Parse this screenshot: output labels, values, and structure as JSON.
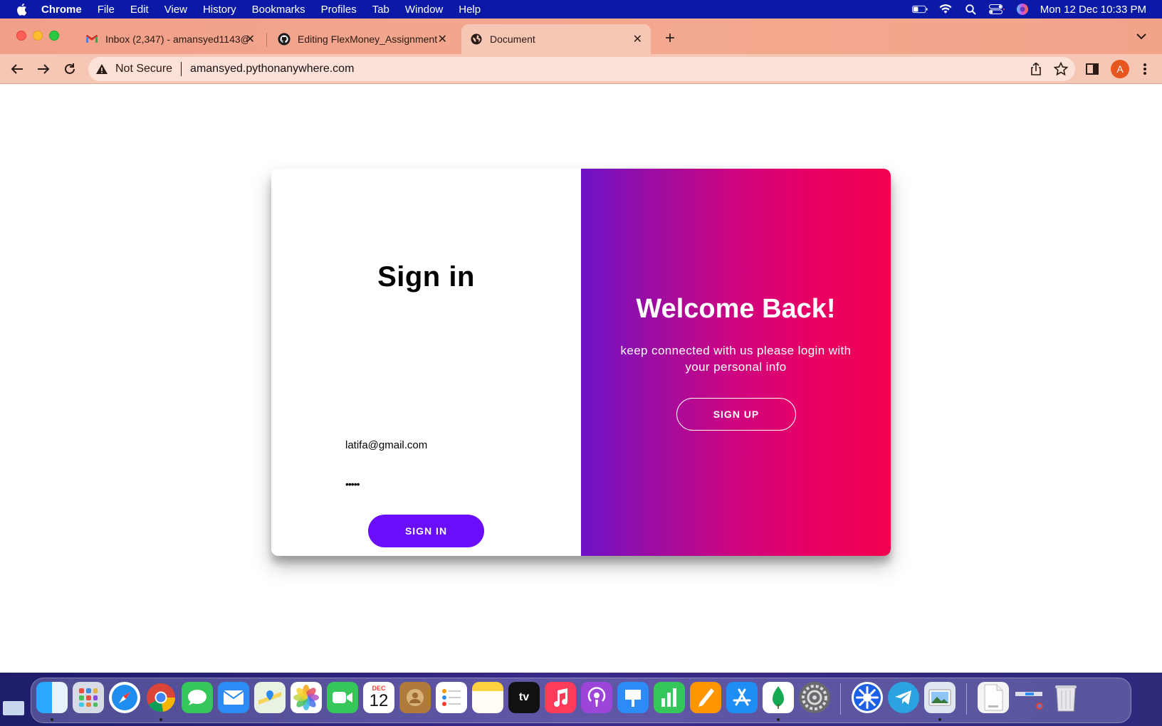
{
  "menubar": {
    "app_name": "Chrome",
    "items": [
      "File",
      "Edit",
      "View",
      "History",
      "Bookmarks",
      "Profiles",
      "Tab",
      "Window",
      "Help"
    ],
    "clock": "Mon 12 Dec  10:33 PM"
  },
  "tabs": [
    {
      "title": "Inbox (2,347) - amansyed1143@",
      "icon": "gmail-icon"
    },
    {
      "title": "Editing FlexMoney_Assignment",
      "icon": "github-icon"
    },
    {
      "title": "Document",
      "icon": "globe-icon",
      "active": true
    }
  ],
  "toolbar": {
    "security_label": "Not Secure",
    "url": "amansyed.pythonanywhere.com",
    "avatar_letter": "A"
  },
  "signin": {
    "title": "Sign in",
    "email_value": "latifa@gmail.com",
    "password_value": "•••••",
    "button_label": "SIGN IN"
  },
  "welcome": {
    "title": "Welcome Back!",
    "subtitle": "keep connected with us please login with your personal info",
    "button_label": "SIGN UP"
  },
  "dock": {
    "calendar_month": "DEC",
    "calendar_day": "12",
    "tv_label": "tv"
  },
  "colors": {
    "signin_button": "#6a0dfa",
    "gradient_start": "#6e12c8",
    "gradient_end": "#f2004f",
    "menubar": "#0a1aa6",
    "tabstrip": "#f2a08a"
  }
}
